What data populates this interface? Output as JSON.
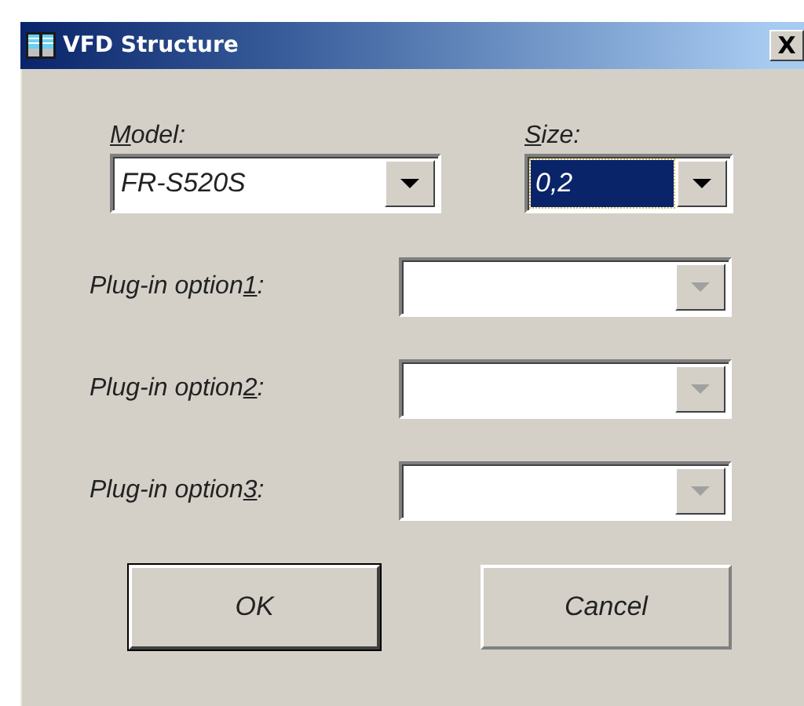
{
  "window": {
    "title": "VFD Structure",
    "close": "X"
  },
  "top_fields": [
    {
      "label_parts": {
        "key": "M",
        "after": "odel:"
      },
      "value": "FR-S520S",
      "highlighted": false,
      "disabled": false
    },
    {
      "label_parts": {
        "key": "S",
        "after": "ize:"
      },
      "value": "0,2",
      "highlighted": true,
      "disabled": false
    }
  ],
  "option_fields": [
    {
      "label_parts": {
        "before": "Plug-in option",
        "key": "1",
        "after": ":"
      },
      "disabled": true
    },
    {
      "label_parts": {
        "before": "Plug-in option",
        "key": "2",
        "after": ":"
      },
      "disabled": true
    },
    {
      "label_parts": {
        "before": "Plug-in option",
        "key": "3",
        "after": ":"
      },
      "disabled": true
    }
  ],
  "buttons": [
    {
      "label": "OK",
      "default": true
    },
    {
      "label": "Cancel",
      "default": false
    }
  ]
}
